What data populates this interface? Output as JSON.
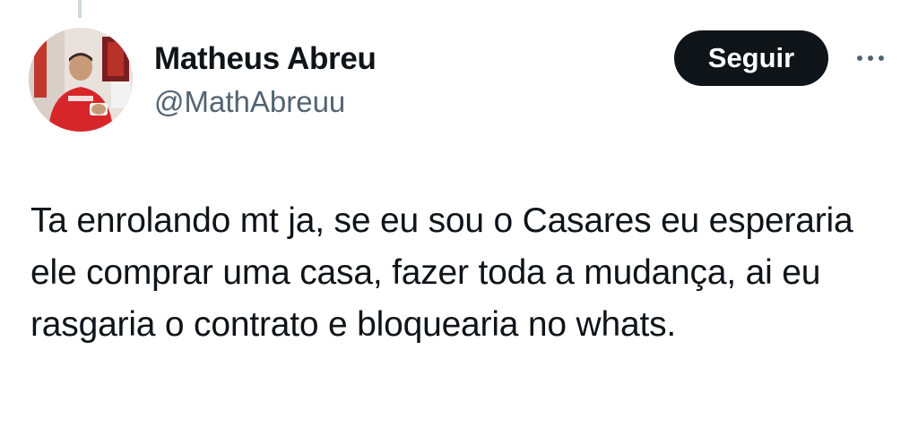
{
  "author": {
    "display_name": "Matheus Abreu",
    "handle": "@MathAbreuu",
    "avatar_icon": "user-avatar-photo"
  },
  "actions": {
    "follow_label": "Seguir",
    "more_icon": "more-options-icon"
  },
  "tweet": {
    "text": "Ta enrolando mt ja, se eu sou o Casares eu esperaria ele comprar uma casa, fazer toda a mudança, ai eu rasgaria o contrato e bloquearia no whats."
  },
  "colors": {
    "text_primary": "#0f1419",
    "text_secondary": "#536471",
    "follow_button_bg": "#0f1419",
    "follow_button_text": "#ffffff",
    "thread_line": "#cfd9de"
  }
}
